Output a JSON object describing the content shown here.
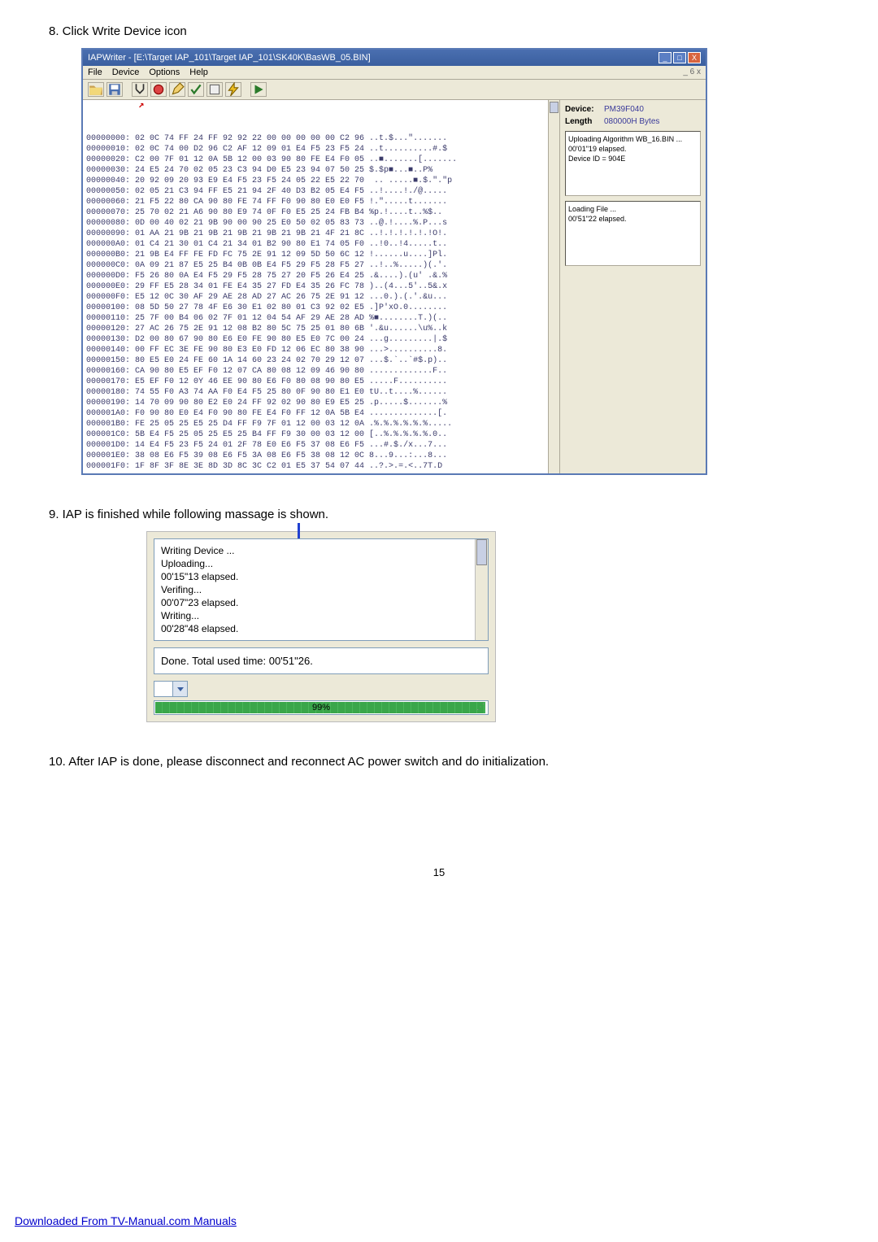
{
  "steps": {
    "s8": "8. Click Write Device icon",
    "s9": "9. IAP is finished while following massage is shown.",
    "s10": "10. After IAP is done, please disconnect and reconnect AC power switch and do initialization."
  },
  "win1": {
    "title": "IAPWriter - [E:\\Target IAP_101\\Target IAP_101\\SK40K\\BasWB_05.BIN]",
    "menus": {
      "file": "File",
      "device": "Device",
      "options": "Options",
      "help": "Help"
    },
    "mdx": "_ 6 x",
    "side": {
      "devlbl": "Device:",
      "devval": "PM39F040",
      "lenlbl": "Length",
      "lenval": "080000H Bytes",
      "status1": "Uploading Algorithm WB_16.BIN ...",
      "status2": "00'01\"19 elapsed.",
      "status3": "Device ID = 904E",
      "status4": "Loading File ...",
      "status5": "00'51\"22 elapsed."
    },
    "hex": [
      "00000000: 02 0C 74 FF 24 FF 92 92 22 00 00 00 00 00 C2 96 ..t.$...\".......",
      "00000010: 02 0C 74 00 D2 96 C2 AF 12 09 01 E4 F5 23 F5 24 ..t..........#.$",
      "00000020: C2 00 7F 01 12 0A 5B 12 00 03 90 80 FE E4 F0 05 ..■.......[.......",
      "00000030: 24 E5 24 70 02 05 23 C3 94 D0 E5 23 94 07 50 25 $.$p■...■..P%",
      "00000040: 20 92 09 20 93 E9 E4 F5 23 F5 24 05 22 E5 22 70  .. .....■.$.\".\"p",
      "00000050: 02 05 21 C3 94 FF E5 21 94 2F 40 D3 B2 05 E4 F5 ..!....!./@.....",
      "00000060: 21 F5 22 80 CA 90 80 FE 74 FF F0 90 80 E0 E0 F5 !.\".....t.......",
      "00000070: 25 70 02 21 A6 90 80 E9 74 0F F0 E5 25 24 FB B4 %p.!....t..%$..",
      "00000080: 0D 00 40 02 21 9B 90 00 90 25 E0 50 02 05 83 73 ..@.!....%.P...s",
      "00000090: 01 AA 21 9B 21 9B 21 9B 21 9B 21 9B 21 4F 21 8C ..!.!.!.!.!.!O!.",
      "000000A0: 01 C4 21 30 01 C4 21 34 01 B2 90 80 E1 74 05 F0 ..!0..!4.....t..",
      "000000B0: 21 9B E4 FF FE FD FC 75 2E 91 12 09 5D 50 6C 12 !......u....]Pl.",
      "000000C0: 0A 09 21 87 E5 25 B4 0B 0B E4 F5 29 F5 28 F5 27 ..!..%.....)(.'.",
      "000000D0: F5 26 80 0A E4 F5 29 F5 28 75 27 20 F5 26 E4 25 .&....).(u' .&.%",
      "000000E0: 29 FF E5 28 34 01 FE E4 35 27 FD E4 35 26 FC 78 )..(4...5'..5&.x",
      "000000F0: E5 12 0C 30 AF 29 AE 28 AD 27 AC 26 75 2E 91 12 ...0.).(.'.&u...",
      "00000100: 08 5D 50 27 78 4F E6 30 E1 02 80 01 C3 92 02 E5 .]P'xO.0........",
      "00000110: 25 7F 00 B4 06 02 7F 01 12 04 54 AF 29 AE 28 AD %■........T.)(..",
      "00000120: 27 AC 26 75 2E 91 12 08 B2 80 5C 75 25 01 80 6B '.&u......\\u%..k",
      "00000130: D2 00 80 67 90 80 E6 E0 FE 90 80 E5 E0 7C 00 24 ...g.........|.$",
      "00000140: 00 FF EC 3E FE 90 80 E3 E0 FD 12 06 EC 80 38 90 ...>..........8.",
      "00000150: 80 E5 E0 24 FE 60 1A 14 60 23 24 02 70 29 12 07 ...$.`..`#$.p)..",
      "00000160: CA 90 80 E5 EF F0 12 07 CA 80 08 12 09 46 90 80 .............F..",
      "00000170: E5 EF F0 12 0Y 46 EE 90 80 E6 F0 80 08 90 80 E5 .....F..........",
      "00000180: 74 55 F0 A3 74 AA F0 E4 F5 25 80 0F 90 80 E1 E0 tU..t....%......",
      "00000190: 14 70 09 90 80 E2 E0 24 FF 92 02 90 80 E9 E5 25 .p.....$.......%",
      "000001A0: F0 90 80 E0 E4 F0 90 80 FE E4 F0 FF 12 0A 5B E4 ..............[.",
      "000001B0: FE 25 05 25 E5 25 D4 FF F9 7F 01 12 00 03 12 0A .%.%.%.%.%.%.....",
      "000001C0: 5B E4 F5 25 05 25 E5 25 B4 FF F9 30 00 03 12 00 [..%.%.%.%.%.0..",
      "000001D0: 14 E4 F5 23 F5 24 01 2F 78 E0 E6 F5 37 08 E6 F5 ...#.$./x...7...",
      "000001E0: 38 08 E6 F5 39 08 E6 F5 3A 08 E6 F5 38 08 12 0C 8...9...:...8...",
      "000001F0: 1F 8F 3F 8E 3E 8D 3D 8C 3C C2 01 E5 37 54 07 44 ..?.>.=.<..7T.D"
    ]
  },
  "win2": {
    "lines": {
      "l1": "Writing Device ...",
      "l2": "Uploading...",
      "l3": "00'15\"13 elapsed.",
      "l4": "Verifing...",
      "l5": "00'07\"23 elapsed.",
      "l6": "Writing...",
      "l7": "00'28\"48 elapsed."
    },
    "done": "Done.  Total used time: 00'51\"26.",
    "pct": "99%"
  },
  "pagenum": "15",
  "footer": "Downloaded From TV-Manual.com Manuals"
}
